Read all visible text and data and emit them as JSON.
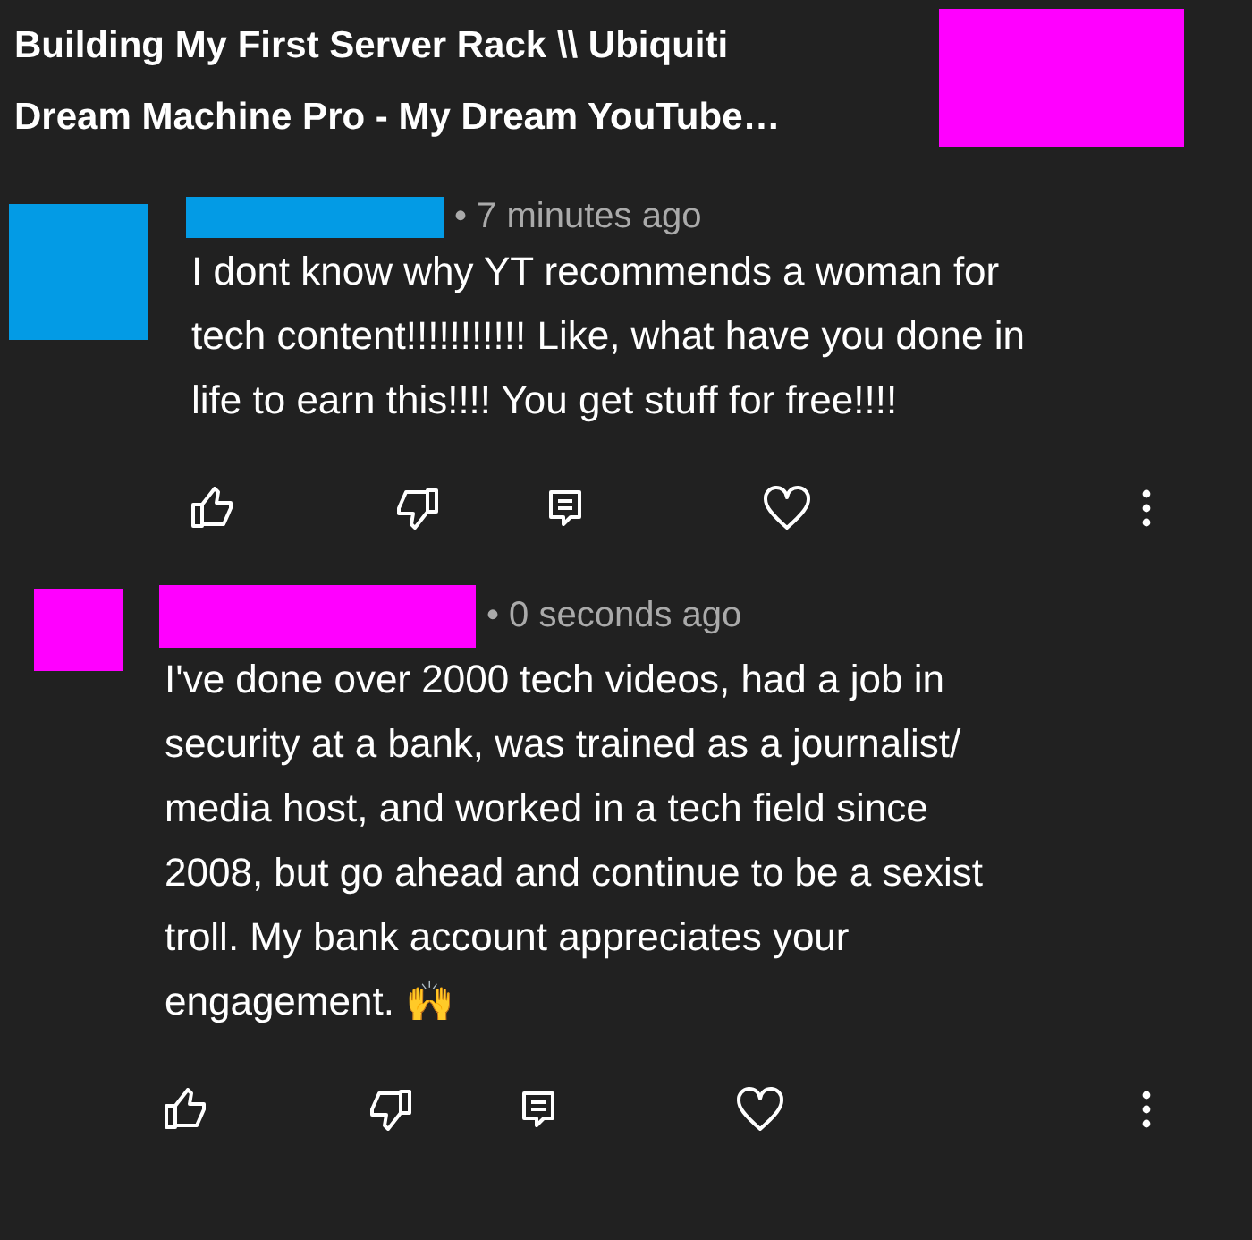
{
  "video_title": "Building My First Server Rack \\\\ Ubiquiti Dream Machine Pro - My Dream YouTube…",
  "comments": [
    {
      "color": "#039be5",
      "time": "• 7 minutes ago",
      "text": "I dont know why YT recommends a woman for tech content!!!!!!!!!!! Like, what have you done in life to earn this!!!! You get stuff for free!!!!",
      "reply": false
    },
    {
      "color": "#ff00ff",
      "time": "• 0 seconds ago",
      "text": "I've done over 2000 tech videos, had a job in security at a bank, was trained as a journalist/ media host, and worked in a tech field since 2008, but go ahead and continue to be a sexist troll. My bank account  appreciates your engagement. 🙌",
      "reply": true
    }
  ]
}
